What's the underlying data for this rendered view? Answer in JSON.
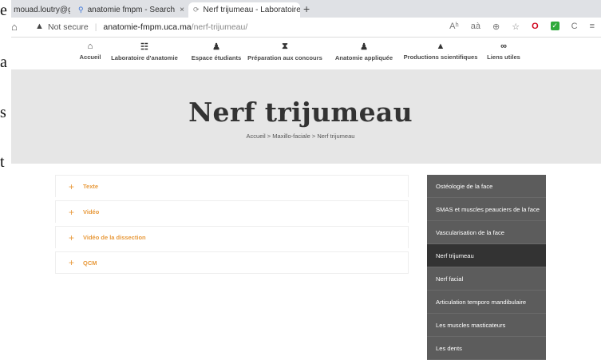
{
  "browser": {
    "tabs": [
      {
        "label": "i - mouad.loutry@g",
        "icon": "user-icon"
      },
      {
        "label": "anatomie fmpm - Search",
        "icon": "search-icon"
      },
      {
        "label": "Nerf trijumeau - Laboratoire d'a",
        "icon": "loading-icon"
      }
    ],
    "new_tab_label": "+",
    "close_label": "×",
    "security_label": "Not secure",
    "url_host": "anatomie-fmpm.uca.ma",
    "url_path": "/nerf-trijumeau/",
    "toolbar_text_icon": "Aʰ",
    "toolbar_read_icon": "aà",
    "toolbar_zoom_icon": "⊕",
    "toolbar_fav_icon": "☆",
    "toolbar_ext1_icon": "O",
    "toolbar_ext2_icon": "✓",
    "toolbar_refresh_icon": "C",
    "toolbar_collections_icon": "≡"
  },
  "left_strip_letters": [
    "e",
    "a",
    "s",
    "t"
  ],
  "nav": {
    "items": [
      {
        "label": "Accueil",
        "icon": "home-icon",
        "glyph": "⌂"
      },
      {
        "label": "Laboratoire d'anatomie",
        "icon": "group-icon",
        "glyph": "☷"
      },
      {
        "label": "Espace étudiants",
        "icon": "student-icon",
        "glyph": "♟"
      },
      {
        "label": "Préparation aux concours",
        "icon": "hourglass-icon",
        "glyph": "⧗"
      },
      {
        "label": "Anatomie appliquée",
        "icon": "doctor-icon",
        "glyph": "♟"
      },
      {
        "label": "Productions scientifiques",
        "icon": "graduation-cap-icon",
        "glyph": "▲"
      },
      {
        "label": "Liens utiles",
        "icon": "link-icon",
        "glyph": "∞"
      }
    ]
  },
  "hero": {
    "title": "Nerf trijumeau",
    "breadcrumb": "Accueil > Maxillo-faciale > Nerf trijumeau"
  },
  "accordion": {
    "plus": "+",
    "items": [
      {
        "label": "Texte"
      },
      {
        "label": "Vidéo"
      },
      {
        "label": "Vidéo de la dissection"
      },
      {
        "label": "QCM"
      }
    ]
  },
  "sidebar": {
    "items": [
      {
        "label": "Ostéologie de la face"
      },
      {
        "label": "SMAS et muscles peauciers de la face"
      },
      {
        "label": "Vascularisation de la face"
      },
      {
        "label": "Nerf trijumeau",
        "active": true
      },
      {
        "label": "Nerf facial"
      },
      {
        "label": "Articulation temporo mandibulaire"
      },
      {
        "label": "Les muscles masticateurs"
      },
      {
        "label": "Les dents"
      }
    ]
  }
}
